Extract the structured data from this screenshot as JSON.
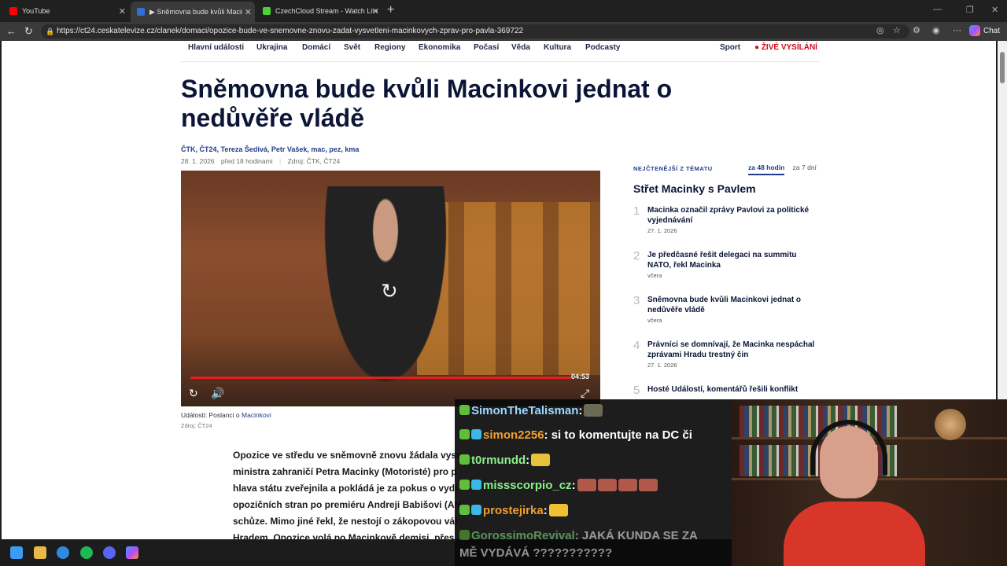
{
  "browser": {
    "tabs": [
      {
        "title": "YouTube",
        "favicon_color": "#ff0000"
      },
      {
        "title": "▶ Sněmovna bude kvůli Macinkov",
        "favicon_color": "#2f6fd6"
      },
      {
        "title": "CzechCloud Stream - Watch Live o",
        "favicon_color": "#4cd137"
      }
    ],
    "url": "https://ct24.ceskatelevize.cz/clanek/domaci/opozice-bude-ve-snemovne-znovu-zadat-vysvetleni-macinkovych-zprav-pro-pavla-369722",
    "chat_button": "Chat"
  },
  "site": {
    "nav": [
      "Hlavní události",
      "Ukrajina",
      "Domácí",
      "Svět",
      "Regiony",
      "Ekonomika",
      "Počasí",
      "Věda",
      "Kultura",
      "Podcasty"
    ],
    "nav_right": [
      "Sport",
      "● ŽIVÉ VYSÍLÁNÍ"
    ]
  },
  "article": {
    "title": "Sněmovna bude kvůli Macinkovi jednat o nedůvěře vládě",
    "authors": "ČTK, ČT24, Tereza Šedivá, Petr Vašek, mac, pez, kma",
    "date": "28. 1. 2026",
    "relative_time": "před 18 hodinami",
    "source": "Zdroj: ČTK, ČT24",
    "video_duration": "04:53",
    "video_progress": 0.91,
    "caption_prefix": "Události: Poslanci o ",
    "caption_link": "Macinkovi",
    "caption_source": "Zdroj: ČT24",
    "body_lines": [
      "Opozice ve středu ve sněmovně znovu žádala vysv",
      "ministra zahraničí Petra Macinky (Motoristé) pro p",
      "hlava státu zveřejnila a pokládá je za pokus o vydí",
      "opozičních stran po premiéru Andreji Babišovi (AN",
      "schůze. Mimo jiné řekl, že nestojí o zákopovou vál",
      "Hradem. Opozice volá po Macinkově demisi, přes"
    ]
  },
  "sidebar": {
    "header": "NEJČTENĚJŠÍ Z TÉMATU",
    "tab_active": "za 48 hodin",
    "tab_other": "za 7 dní",
    "title": "Střet Macinky s Pavlem",
    "items": [
      {
        "num": "1",
        "text": "Macinka označil zprávy Pavlovi za politické vyjednávání",
        "date": "27. 1. 2026"
      },
      {
        "num": "2",
        "text": "Je předčasné řešit delegaci na summitu NATO, řekl Macinka",
        "date": "včera"
      },
      {
        "num": "3",
        "text": "Sněmovna bude kvůli Macinkovi jednat o nedůvěře vládě",
        "date": "včera"
      },
      {
        "num": "4",
        "text": "Právníci se domnívají, že Macinka nespáchal zprávami Hradu trestný čin",
        "date": "27. 1. 2026"
      },
      {
        "num": "5",
        "text": "Hosté Událostí, komentářů řešili konflikt",
        "date": ""
      }
    ]
  },
  "chat": {
    "messages": [
      {
        "user": "SimonTheTalisman",
        "text": "",
        "color": "#9fd8ff",
        "emotes": 1
      },
      {
        "user": "simon2256",
        "text": "si to komentujte na DC či",
        "color": "#f0a030",
        "emotes": 0
      },
      {
        "user": "t0rmundd",
        "text": "",
        "color": "#8cf08c",
        "emotes": 1
      },
      {
        "user": "missscorpio_cz",
        "text": "",
        "color": "#8cf08c",
        "emotes": 4
      },
      {
        "user": "prostejirka",
        "text": "",
        "color": "#f0a030",
        "emotes": 1
      },
      {
        "user": "GorossimoRevival",
        "text": "JAKÁ KUNDA SE ZA",
        "color": "#8cf08c",
        "emotes": 0
      },
      {
        "user": "",
        "text": "MĚ VYDÁVÁ ???????????",
        "color": "#ffffff",
        "emotes": 0
      }
    ]
  }
}
